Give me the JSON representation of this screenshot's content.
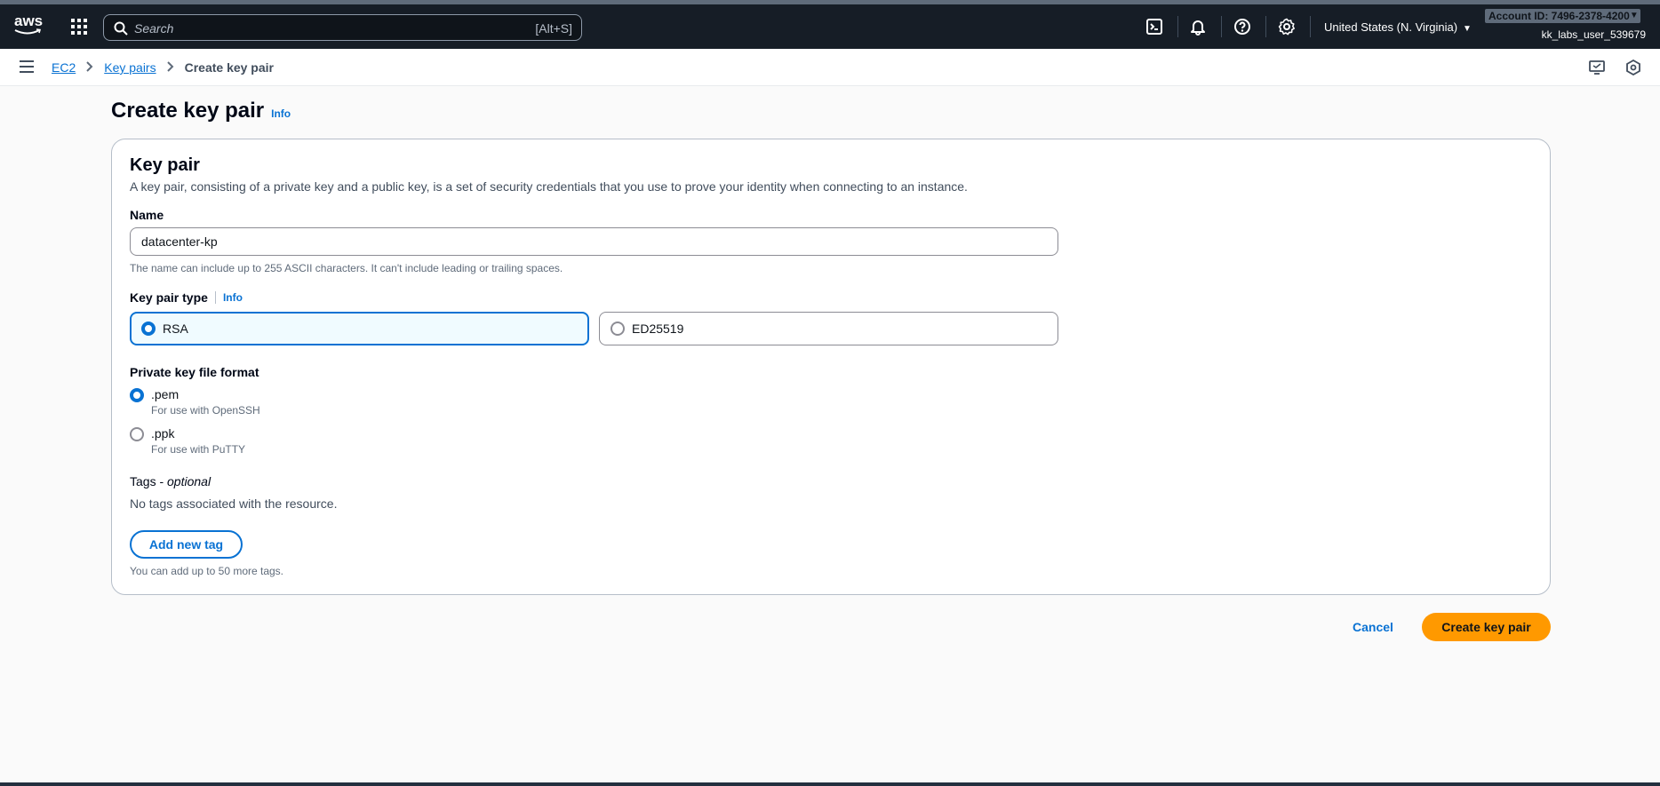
{
  "topnav": {
    "logo_text": "aws",
    "search_placeholder": "Search",
    "search_shortcut": "[Alt+S]",
    "region": "United States (N. Virginia)",
    "account": "Account ID: 7496-2378-4200",
    "user": "kk_labs_user_539679",
    "icons": [
      "apps-icon",
      "search-icon",
      "cloudshell-icon",
      "bell-icon",
      "help-icon",
      "settings-icon"
    ]
  },
  "breadcrumb": {
    "items": [
      "EC2",
      "Key pairs"
    ],
    "current": "Create key pair"
  },
  "page": {
    "title": "Create key pair",
    "info": "Info"
  },
  "panel": {
    "title": "Key pair",
    "description": "A key pair, consisting of a private key and a public key, is a set of security credentials that you use to prove your identity when connecting to an instance.",
    "name_label": "Name",
    "name_value": "datacenter-kp",
    "name_hint": "The name can include up to 255 ASCII characters. It can't include leading or trailing spaces.",
    "type_label": "Key pair type",
    "type_info": "Info",
    "type_options": [
      {
        "label": "RSA",
        "selected": true
      },
      {
        "label": "ED25519",
        "selected": false
      }
    ],
    "format_label": "Private key file format",
    "format_options": [
      {
        "label": ".pem",
        "desc": "For use with OpenSSH",
        "selected": true
      },
      {
        "label": ".ppk",
        "desc": "For use with PuTTY",
        "selected": false
      }
    ],
    "tags_label": "Tags - ",
    "tags_optional": "optional",
    "tags_none": "No tags associated with the resource.",
    "add_tag_label": "Add new tag",
    "tags_hint": "You can add up to 50 more tags."
  },
  "actions": {
    "cancel": "Cancel",
    "create": "Create key pair"
  },
  "colors": {
    "nav_bg": "#161d26",
    "link": "#0972d3",
    "primary_button": "#ff9900"
  }
}
